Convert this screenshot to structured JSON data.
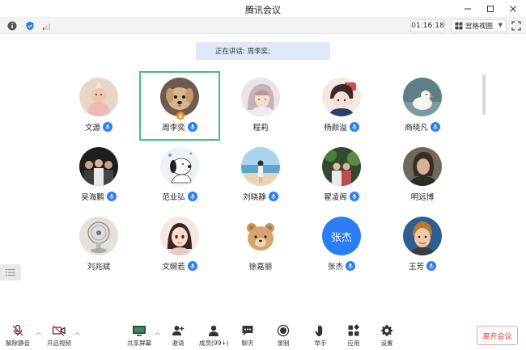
{
  "window": {
    "title": "腾讯会议"
  },
  "toolbar": {
    "timer": "01:16:18",
    "view_label": "宫格视图"
  },
  "speaking": {
    "text": "正在讲话: 周李奕;"
  },
  "participants": [
    {
      "name": "文源",
      "mic": true,
      "avatar": "baby-photo"
    },
    {
      "name": "周李奕",
      "mic": true,
      "active": true,
      "host": true,
      "avatar": "dog-photo"
    },
    {
      "name": "程莉",
      "mic": false,
      "avatar": "anime-girl"
    },
    {
      "name": "杨颜溢",
      "mic": true,
      "avatar": "anime-boy"
    },
    {
      "name": "商晓凡",
      "mic": true,
      "avatar": "duck-photo"
    },
    {
      "name": "吴海鹏",
      "mic": true,
      "avatar": "group-photo"
    },
    {
      "name": "范业弘",
      "mic": true,
      "avatar": "snoopy"
    },
    {
      "name": "刘晓静",
      "mic": true,
      "avatar": "beach-photo"
    },
    {
      "name": "翟凌阁",
      "mic": true,
      "avatar": "couple-photo"
    },
    {
      "name": "明远博",
      "mic": false,
      "avatar": "portrait-photo"
    },
    {
      "name": "刘兆斌",
      "mic": false,
      "avatar": "fan-photo"
    },
    {
      "name": "文婉若",
      "mic": true,
      "avatar": "cartoon-girl"
    },
    {
      "name": "徐嘉丽",
      "mic": false,
      "avatar": "bear-emoji"
    },
    {
      "name": "张杰",
      "mic": true,
      "avatar": "text-avatar",
      "avatar_text": "张杰"
    },
    {
      "name": "王芳",
      "mic": true,
      "avatar": "kid-photo"
    }
  ],
  "bottom": {
    "unmute": "解除静音",
    "video": "开启视频",
    "share": "共享屏幕",
    "invite": "邀请",
    "members": "成员(99+)",
    "chat": "聊天",
    "record": "录制",
    "raise": "举手",
    "apps": "应用",
    "settings": "设置",
    "leave": "离开会议"
  },
  "colors": {
    "accent": "#2a7ef5",
    "active_border": "#3cc17f",
    "leave": "#e23b3b",
    "banner": "#dfe9f7"
  }
}
